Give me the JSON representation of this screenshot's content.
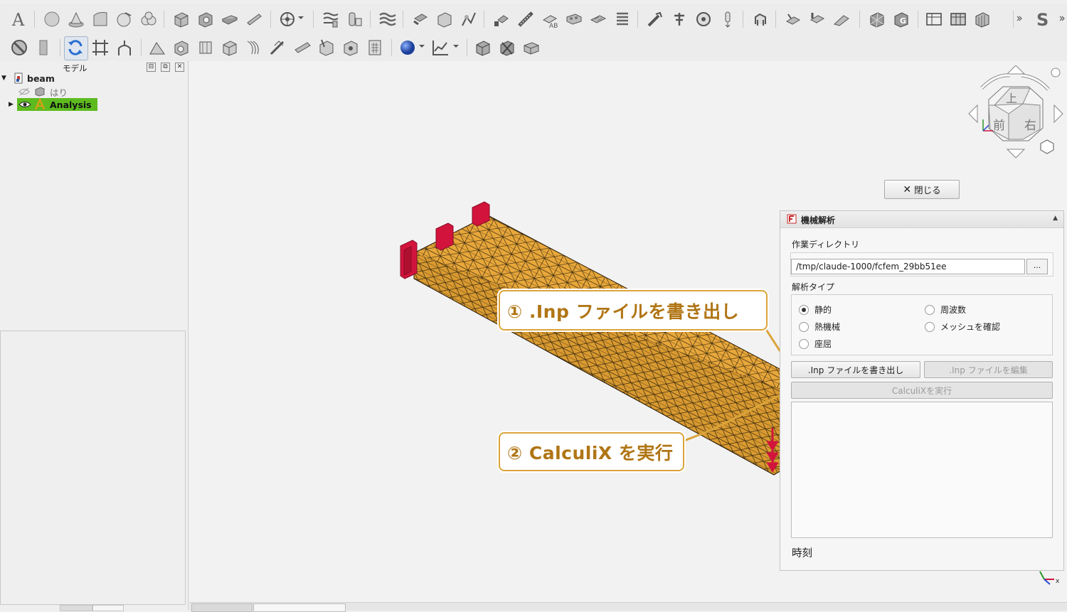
{
  "tree": {
    "panel_title": "モデル",
    "root_label": "beam",
    "child_label": "はり",
    "analysis_label": "Analysis"
  },
  "task_panel": {
    "close_label": "閉じる",
    "title": "機械解析",
    "working_dir_label": "作業ディレクトリ",
    "working_dir_value": "/tmp/claude-1000/fcfem_29bb51ee",
    "browse_label": "...",
    "analysis_type_label": "解析タイプ",
    "analysis_types": [
      "静的",
      "周波数",
      "熱機械",
      "メッシュを確認",
      "座屈"
    ],
    "selected_type": "静的",
    "write_inp_label": ".Inp ファイルを書き出し",
    "edit_inp_label": ".Inp ファイルを編集",
    "run_label": "CalculiXを実行",
    "time_label": "時刻"
  },
  "callouts": {
    "step1": "① .Inp ファイルを書き出し",
    "step2": "② CalculiX を実行"
  },
  "navcube": {
    "top": "上",
    "front": "前",
    "right": "右"
  },
  "colors": {
    "mesh_fill": "#e8a73a",
    "constraint": "#d2143c",
    "callout_border": "#dba43a",
    "selected_tree": "#5dbb1f"
  }
}
